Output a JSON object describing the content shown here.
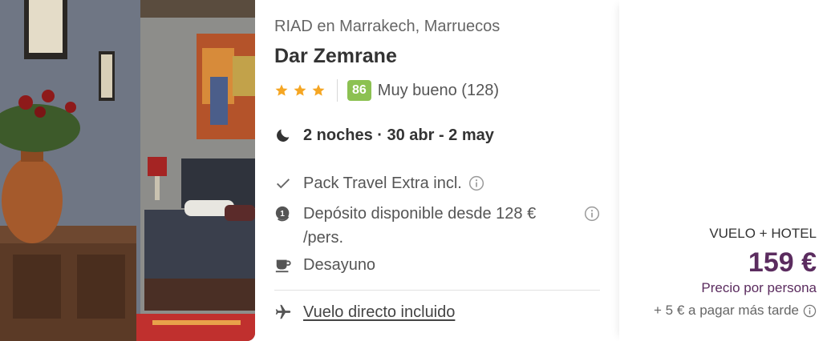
{
  "hotel": {
    "location": "RIAD en Marrakech, Marruecos",
    "name": "Dar Zemrane",
    "stars": 3,
    "star_color": "#f5a623",
    "score": "86",
    "score_color": "#8cc152",
    "rating_text": "Muy bueno (128)"
  },
  "stay": {
    "dates": "2 noches · 30 abr - 2 may"
  },
  "features": [
    {
      "icon": "check-icon",
      "text": "Pack Travel Extra incl."
    },
    {
      "icon": "deposit-icon",
      "text": "Depósito disponible desde 128 € /pers."
    },
    {
      "icon": "coffee-cup-icon",
      "text": "Desayuno"
    }
  ],
  "flight": {
    "icon": "plane-icon",
    "text": "Vuelo directo incluido"
  },
  "price": {
    "package_type": "VUELO + HOTEL",
    "amount": "159 €",
    "per_person": "Precio por persona",
    "later": "+ 5 € a pagar más tarde",
    "accent_color": "#5b2c5f"
  }
}
